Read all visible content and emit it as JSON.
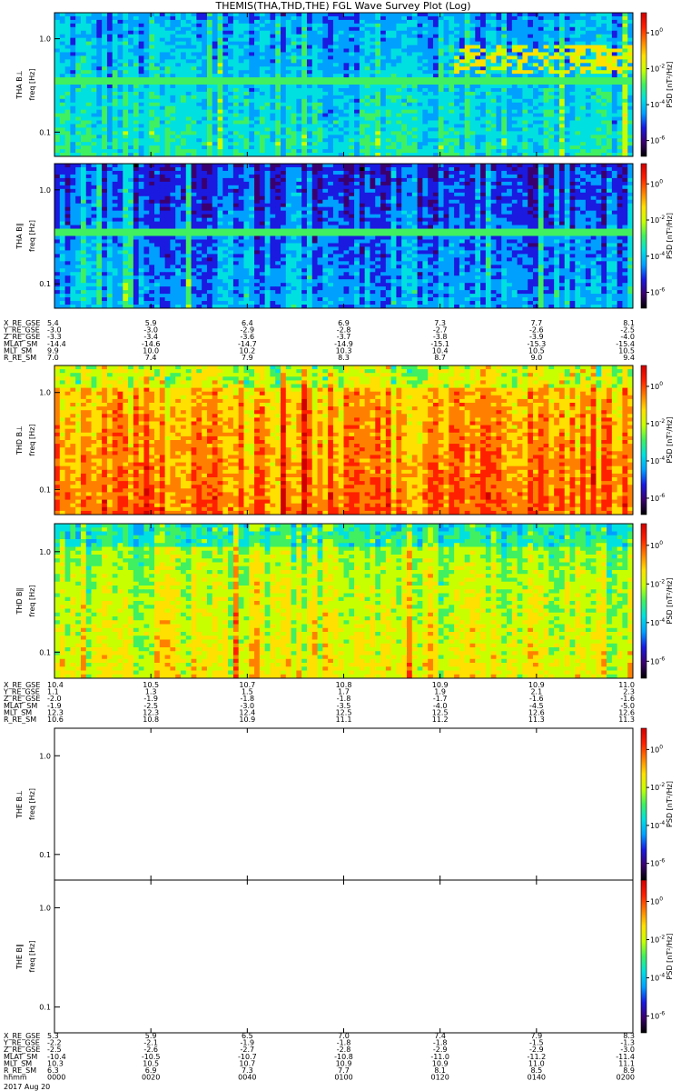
{
  "title": "THEMIS(THA,THD,THE) FGL Wave Survey Plot (Log)",
  "date_label": "2017 Aug 20",
  "colorbar": {
    "label": "PSD [nT²/Hz]",
    "ticks": [
      {
        "value": "10",
        "exp": "0"
      },
      {
        "value": "10",
        "exp": "-2"
      },
      {
        "value": "10",
        "exp": "-4"
      },
      {
        "value": "10",
        "exp": "-6"
      }
    ],
    "colors": [
      "#000000",
      "#3a0070",
      "#1a1ae0",
      "#00a0ff",
      "#00e0e0",
      "#40f060",
      "#c8ff00",
      "#ffe000",
      "#ff8000",
      "#ff2000",
      "#d00000"
    ]
  },
  "chart_data": [
    {
      "type": "heatmap",
      "ylabel": "THA B⊥",
      "yunit": "freq [Hz]",
      "yscale": "log",
      "yticks": [
        "1.0",
        "0.1"
      ],
      "has_data": true,
      "intensity": "low",
      "bands": [
        "0.40 Hz bright band",
        "0.6-0.9 Hz enhancement after ~01:10"
      ]
    },
    {
      "type": "heatmap",
      "ylabel": "THA B∥",
      "yunit": "freq [Hz]",
      "yscale": "log",
      "yticks": [
        "1.0",
        "0.1"
      ],
      "has_data": true,
      "intensity": "very-low",
      "bands": [
        "0.40 Hz bright band"
      ]
    },
    {
      "type": "table",
      "name": "THA ephemeris",
      "rows": [
        {
          "label": "X_RE_GSE",
          "values": [
            "5.4",
            "5.9",
            "6.4",
            "6.9",
            "7.3",
            "7.7",
            "8.1"
          ]
        },
        {
          "label": "Y_RE_GSE",
          "values": [
            "-3.0",
            "-3.0",
            "-2.9",
            "-2.8",
            "-2.7",
            "-2.6",
            "-2.5"
          ]
        },
        {
          "label": "Z_RE_GSE",
          "values": [
            "-3.3",
            "-3.4",
            "-3.6",
            "-3.7",
            "-3.8",
            "-3.9",
            "-4.0"
          ]
        },
        {
          "label": "MLAT_SM",
          "values": [
            "-14.4",
            "-14.6",
            "-14.7",
            "-14.9",
            "-15.1",
            "-15.3",
            "-15.4"
          ]
        },
        {
          "label": "MLT_SM",
          "values": [
            "9.9",
            "10.0",
            "10.2",
            "10.3",
            "10.4",
            "10.5",
            "10.5"
          ]
        },
        {
          "label": "R_RE_SM",
          "values": [
            "7.0",
            "7.4",
            "7.9",
            "8.3",
            "8.7",
            "9.0",
            "9.4"
          ]
        }
      ]
    },
    {
      "type": "heatmap",
      "ylabel": "THD B⊥",
      "yunit": "freq [Hz]",
      "yscale": "log",
      "yticks": [
        "1.0",
        "0.1"
      ],
      "has_data": true,
      "intensity": "high"
    },
    {
      "type": "heatmap",
      "ylabel": "THD B∥",
      "yunit": "freq [Hz]",
      "yscale": "log",
      "yticks": [
        "1.0",
        "0.1"
      ],
      "has_data": true,
      "intensity": "mid"
    },
    {
      "type": "table",
      "name": "THD ephemeris",
      "rows": [
        {
          "label": "X_RE_GSE",
          "values": [
            "10.4",
            "10.5",
            "10.7",
            "10.8",
            "10.9",
            "10.9",
            "11.0"
          ]
        },
        {
          "label": "Y_RE_GSE",
          "values": [
            "1.1",
            "1.3",
            "1.5",
            "1.7",
            "1.9",
            "2.1",
            "2.3"
          ]
        },
        {
          "label": "Z_RE_GSE",
          "values": [
            "-2.0",
            "-1.9",
            "-1.8",
            "-1.8",
            "-1.7",
            "-1.6",
            "-1.6"
          ]
        },
        {
          "label": "MLAT_SM",
          "values": [
            "-1.9",
            "-2.5",
            "-3.0",
            "-3.5",
            "-4.0",
            "-4.5",
            "-5.0"
          ]
        },
        {
          "label": "MLT_SM",
          "values": [
            "12.3",
            "12.3",
            "12.4",
            "12.5",
            "12.5",
            "12.6",
            "12.6"
          ]
        },
        {
          "label": "R_RE_SM",
          "values": [
            "10.6",
            "10.8",
            "10.9",
            "11.1",
            "11.2",
            "11.3",
            "11.3"
          ]
        }
      ]
    },
    {
      "type": "heatmap",
      "ylabel": "THE B⊥",
      "yunit": "freq [Hz]",
      "yscale": "log",
      "yticks": [
        "1.0",
        "0.1"
      ],
      "has_data": false
    },
    {
      "type": "heatmap",
      "ylabel": "THE B∥",
      "yunit": "freq [Hz]",
      "yscale": "log",
      "yticks": [
        "1.0",
        "0.1"
      ],
      "has_data": false
    },
    {
      "type": "table",
      "name": "THE ephemeris",
      "rows": [
        {
          "label": "X_RE_GSE",
          "values": [
            "5.3",
            "5.9",
            "6.5",
            "7.0",
            "7.4",
            "7.9",
            "8.3"
          ]
        },
        {
          "label": "Y_RE_GSE",
          "values": [
            "-2.2",
            "-2.1",
            "-1.9",
            "-1.8",
            "-1.8",
            "-1.5",
            "-1.3"
          ]
        },
        {
          "label": "Z_RE_GSE",
          "values": [
            "-2.5",
            "-2.6",
            "-2.7",
            "-2.8",
            "-2.9",
            "-2.9",
            "-3.0"
          ]
        },
        {
          "label": "MLAT_SM",
          "values": [
            "-10.4",
            "-10.5",
            "-10.7",
            "-10.8",
            "-11.0",
            "-11.2",
            "-11.4"
          ]
        },
        {
          "label": "MLT_SM",
          "values": [
            "10.3",
            "10.5",
            "10.7",
            "10.9",
            "10.9",
            "11.0",
            "11.1"
          ]
        },
        {
          "label": "R_RE_SM",
          "values": [
            "6.3",
            "6.9",
            "7.3",
            "7.7",
            "8.1",
            "8.5",
            "8.9"
          ]
        },
        {
          "label": "hhmm",
          "values": [
            "0000",
            "0020",
            "0040",
            "0100",
            "0120",
            "0140",
            "0200"
          ]
        }
      ]
    }
  ]
}
